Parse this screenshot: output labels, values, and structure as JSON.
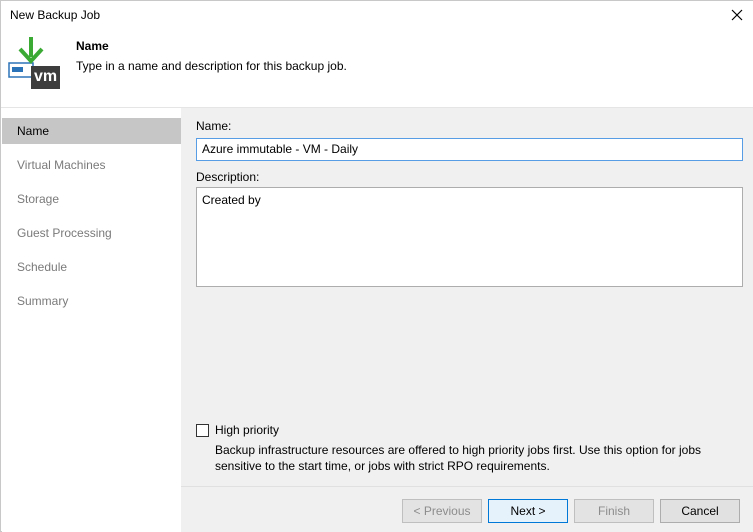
{
  "window": {
    "title": "New Backup Job"
  },
  "header": {
    "title": "Name",
    "description": "Type in a name and description for this backup job.",
    "icon_text": "vm"
  },
  "sidebar": {
    "items": [
      {
        "label": "Name",
        "active": true
      },
      {
        "label": "Virtual Machines",
        "active": false
      },
      {
        "label": "Storage",
        "active": false
      },
      {
        "label": "Guest Processing",
        "active": false
      },
      {
        "label": "Schedule",
        "active": false
      },
      {
        "label": "Summary",
        "active": false
      }
    ]
  },
  "form": {
    "name_label": "Name:",
    "name_value": "Azure immutable - VM - Daily",
    "description_label": "Description:",
    "description_value": "Created by",
    "high_priority_label": "High priority",
    "high_priority_checked": false,
    "high_priority_desc": "Backup infrastructure resources are offered to high priority jobs first. Use this option for jobs sensitive to the start time, or jobs with strict RPO requirements."
  },
  "buttons": {
    "previous": "< Previous",
    "next": "Next >",
    "finish": "Finish",
    "cancel": "Cancel"
  },
  "colors": {
    "accent": "#0078d7",
    "active_nav": "#c6c6c6",
    "panel_bg": "#f0f0f0",
    "icon_green": "#3aaa35"
  }
}
